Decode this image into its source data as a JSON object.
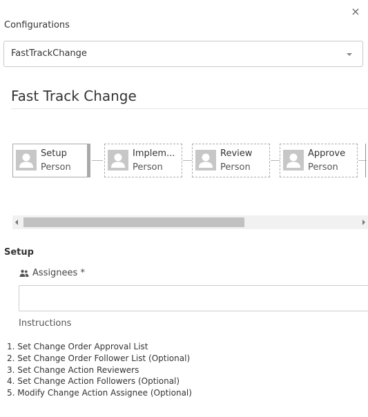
{
  "dialog": {
    "close_symbol": "×"
  },
  "configurations": {
    "label": "Configurations",
    "selected": "FastTrackChange"
  },
  "process": {
    "title": "Fast Track Change",
    "steps": [
      {
        "name": "Setup",
        "role": "Person",
        "state": "active",
        "icon": "person-icon"
      },
      {
        "name": "Implem...",
        "role": "Person",
        "state": "pending",
        "icon": "person-icon"
      },
      {
        "name": "Review",
        "role": "Person",
        "state": "pending",
        "icon": "person-icon"
      },
      {
        "name": "Approve",
        "role": "Person",
        "state": "pending",
        "icon": "person-icon"
      }
    ],
    "scroll_position": 0
  },
  "setup": {
    "heading": "Setup",
    "assignees_label": "Assignees *",
    "assignees_icon": "users-icon",
    "assignees_value": "",
    "instructions_label": "Instructions",
    "instructions": [
      "1. Set Change Order Approval List",
      "2. Set Change Order Follower List (Optional)",
      "3. Set Change Action Reviewers",
      "4. Set Change Action Followers (Optional)",
      "5. Modify Change Action Assignee (Optional)"
    ]
  },
  "colors": {
    "avatar_bg": "#c7c7c7",
    "active_border": "#a9a9a9",
    "text": "#333333"
  }
}
